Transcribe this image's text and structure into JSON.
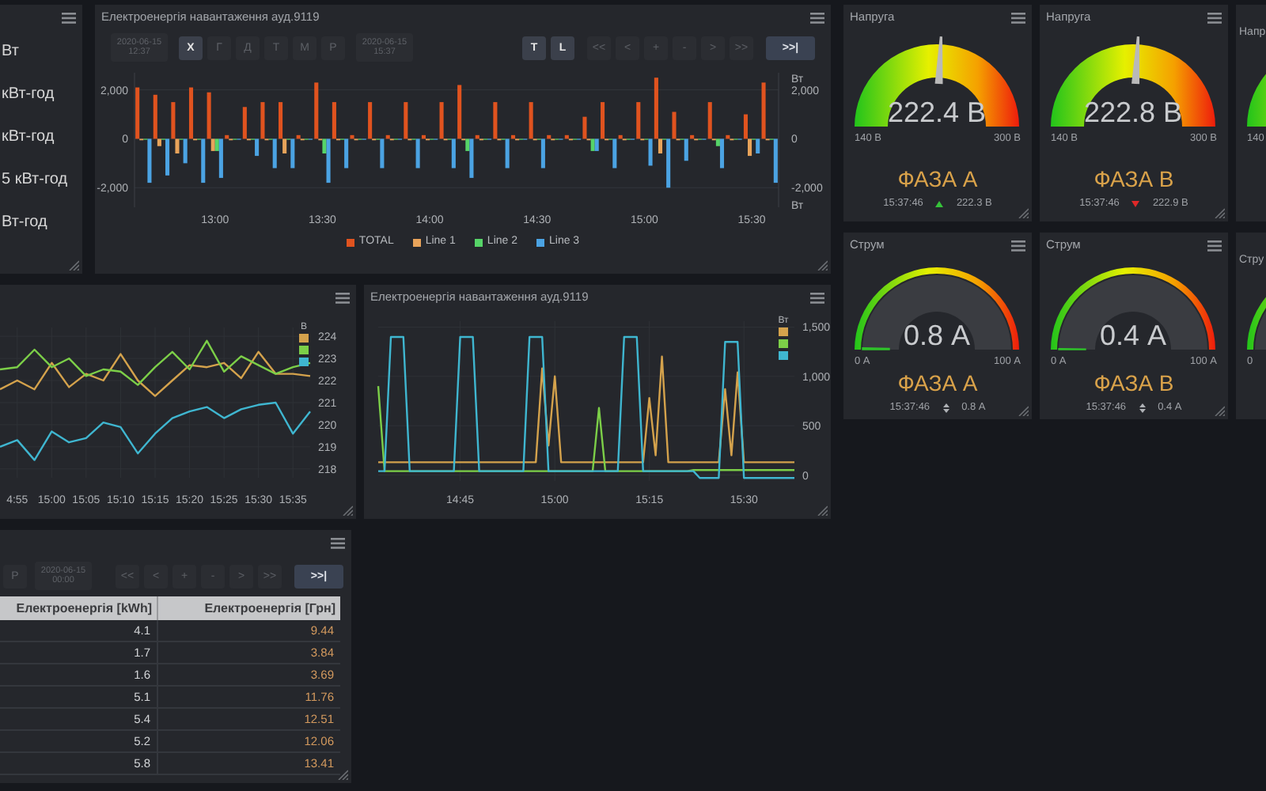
{
  "readings_panel": {
    "readings": [
      "Вт",
      "кВт-год",
      "кВт-год",
      "5 кВт-год",
      "Вт-год"
    ]
  },
  "energy_chart": {
    "title": "Електроенергія навантаження ауд.9119",
    "toolbar": {
      "start": "2020-06-15 12:37",
      "periods": [
        {
          "label": "Х",
          "selected": true
        },
        {
          "label": "Г",
          "selected": false
        },
        {
          "label": "Д",
          "selected": false
        },
        {
          "label": "Т",
          "selected": false
        },
        {
          "label": "М",
          "selected": false
        },
        {
          "label": "Р",
          "selected": false
        }
      ],
      "end": "2020-06-15 15:37",
      "modes": [
        {
          "label": "T",
          "selected": true
        },
        {
          "label": "L",
          "selected": true
        }
      ],
      "nav": [
        "<<",
        "<",
        "+",
        "-",
        ">",
        ">>"
      ],
      "live": ">>|"
    },
    "chart_data": {
      "type": "bar",
      "grid": true,
      "legend": "bottom",
      "y2label": "Вт",
      "annotations": [
        {
          "text": "Вт"
        }
      ],
      "ylim": [
        -2800,
        2700
      ],
      "y2lim": [
        -2800,
        2700
      ],
      "categories": [
        null,
        null,
        null,
        null,
        "13:00",
        null,
        null,
        null,
        null,
        null,
        "13:30",
        null,
        null,
        null,
        null,
        null,
        "14:00",
        null,
        null,
        null,
        null,
        null,
        "14:30",
        null,
        null,
        null,
        null,
        null,
        "15:00",
        null,
        null,
        null,
        null,
        null,
        "15:30",
        null
      ],
      "yticks": [
        {
          "value": 2000,
          "label": "2,000"
        },
        {
          "value": 0,
          "label": "0"
        },
        {
          "value": -2000,
          "label": "-2,000"
        }
      ],
      "y2ticks": [
        {
          "value": 2000,
          "label": "2,000"
        },
        {
          "value": 0,
          "label": "0"
        },
        {
          "value": -2000,
          "label": "-2,000"
        }
      ],
      "series": [
        {
          "name": "TOTAL",
          "color": "#e0531f",
          "values": [
            2100,
            1800,
            1500,
            2100,
            1900,
            150,
            1300,
            1500,
            1500,
            150,
            2300,
            1500,
            150,
            1500,
            150,
            1500,
            150,
            1500,
            2200,
            150,
            1500,
            150,
            1500,
            150,
            150,
            900,
            1500,
            150,
            1500,
            2500,
            1100,
            150,
            1500,
            150,
            1000,
            2300
          ]
        },
        {
          "name": "Line 1",
          "color": "#e8a35a",
          "values": [
            -60,
            -300,
            -600,
            -60,
            -500,
            -60,
            -60,
            -60,
            -600,
            -60,
            -60,
            -60,
            -60,
            -60,
            -60,
            -60,
            -60,
            -60,
            -60,
            -60,
            -60,
            -60,
            -60,
            -60,
            -60,
            -60,
            -60,
            -60,
            -60,
            -600,
            -60,
            -60,
            -60,
            -60,
            -700,
            -60
          ]
        },
        {
          "name": "Line 2",
          "color": "#56d468",
          "values": [
            -40,
            -40,
            -40,
            -40,
            -500,
            -40,
            -40,
            -40,
            -40,
            -40,
            -600,
            -40,
            -40,
            -40,
            -40,
            -40,
            -40,
            -40,
            -500,
            -40,
            -40,
            -40,
            -40,
            -40,
            -40,
            -500,
            -40,
            -40,
            -40,
            -40,
            -40,
            -40,
            -300,
            -40,
            -40,
            -40
          ]
        },
        {
          "name": "Line 3",
          "color": "#4ba3e3",
          "values": [
            -1800,
            -1500,
            -1000,
            -1800,
            -1600,
            -40,
            -700,
            -1200,
            -1200,
            -40,
            -1800,
            -1200,
            -40,
            -1200,
            -40,
            -1200,
            -40,
            -1200,
            -1600,
            -40,
            -1200,
            -40,
            -1200,
            -40,
            -40,
            -500,
            -1200,
            -40,
            -1100,
            -2000,
            -900,
            -40,
            -1200,
            -40,
            -600,
            -1800
          ]
        }
      ]
    }
  },
  "voltage_chart": {
    "chart_data": {
      "type": "line",
      "grid": true,
      "ylabel": "В",
      "ylim": [
        217.6,
        224.4
      ],
      "categories": [
        null,
        "4:55",
        null,
        "15:00",
        null,
        "15:05",
        null,
        "15:10",
        null,
        "15:15",
        null,
        "15:20",
        null,
        "15:25",
        null,
        "15:30",
        null,
        "15:35",
        null
      ],
      "yticks": [
        218,
        219,
        220,
        221,
        222,
        223,
        224
      ],
      "series": [
        {
          "color": "#d4a24c",
          "values": [
            221.6,
            222,
            221.6,
            222.8,
            221.7,
            222.3,
            222,
            223.2,
            222,
            221.3,
            222,
            222.7,
            222.6,
            222.8,
            222.1,
            223.3,
            222.3,
            222.3,
            222.2
          ]
        },
        {
          "color": "#7ccf48",
          "values": [
            222.5,
            222.6,
            223.4,
            222.6,
            223,
            222.2,
            222.5,
            222.4,
            221.8,
            222.6,
            223.3,
            222.5,
            223.8,
            222.4,
            223.1,
            222.7,
            222.3,
            222.6,
            222.8
          ]
        },
        {
          "color": "#3fb6d0",
          "values": [
            219,
            219.3,
            218.4,
            219.7,
            219.2,
            219.4,
            220.1,
            219.9,
            218.7,
            219.6,
            220.3,
            220.6,
            220.8,
            220.3,
            220.7,
            220.9,
            221,
            219.6,
            220.6
          ]
        }
      ]
    }
  },
  "power_chart": {
    "title": "Електроенергія навантаження ауд.9119",
    "chart_data": {
      "type": "line",
      "grid": true,
      "ylabel": "Вт",
      "ylim": [
        -60,
        1560
      ],
      "categories": [
        null,
        null,
        null,
        null,
        null,
        null,
        null,
        null,
        null,
        null,
        null,
        null,
        null,
        "14:45",
        null,
        null,
        null,
        null,
        null,
        null,
        null,
        null,
        null,
        null,
        null,
        null,
        null,
        null,
        "15:00",
        null,
        null,
        null,
        null,
        null,
        null,
        null,
        null,
        null,
        null,
        null,
        null,
        null,
        null,
        "15:15",
        null,
        null,
        null,
        null,
        null,
        null,
        null,
        null,
        null,
        null,
        null,
        null,
        null,
        null,
        "15:30",
        null,
        null,
        null,
        null,
        null,
        null,
        null,
        null
      ],
      "yticks": [
        {
          "value": 1500,
          "label": "1,500"
        },
        {
          "value": 1000,
          "label": "1,000"
        },
        {
          "value": 500,
          "label": "500"
        },
        {
          "value": 0,
          "label": "0"
        }
      ],
      "series": [
        {
          "color": "#d4a24c",
          "values": [
            130,
            130,
            130,
            130,
            130,
            130,
            130,
            130,
            130,
            130,
            130,
            130,
            130,
            130,
            130,
            130,
            130,
            130,
            130,
            130,
            130,
            130,
            130,
            130,
            130,
            130,
            1080,
            300,
            1000,
            130,
            130,
            130,
            130,
            130,
            130,
            130,
            130,
            130,
            130,
            130,
            130,
            130,
            130,
            780,
            200,
            1200,
            130,
            130,
            130,
            130,
            130,
            130,
            130,
            130,
            130,
            870,
            200,
            1040,
            130,
            130,
            130,
            130,
            130,
            130,
            130,
            130,
            130
          ]
        },
        {
          "color": "#7ccf48",
          "values": [
            900,
            40,
            40,
            40,
            40,
            40,
            40,
            40,
            40,
            40,
            40,
            40,
            40,
            40,
            40,
            40,
            40,
            40,
            40,
            40,
            40,
            40,
            40,
            40,
            40,
            40,
            40,
            40,
            40,
            40,
            40,
            40,
            40,
            40,
            40,
            680,
            40,
            40,
            40,
            40,
            40,
            40,
            40,
            40,
            40,
            40,
            40,
            40,
            40,
            40,
            50,
            50,
            50,
            50,
            50,
            50,
            50,
            50,
            50,
            50,
            50,
            50,
            50,
            50,
            50,
            50,
            50
          ]
        },
        {
          "color": "#3fb6d0",
          "values": [
            40,
            40,
            1400,
            1400,
            1400,
            40,
            40,
            40,
            40,
            40,
            40,
            40,
            40,
            1400,
            1400,
            1400,
            40,
            40,
            40,
            40,
            40,
            40,
            40,
            40,
            1400,
            1400,
            1400,
            40,
            40,
            40,
            40,
            40,
            40,
            40,
            40,
            40,
            40,
            40,
            40,
            1400,
            1400,
            1400,
            40,
            40,
            40,
            40,
            40,
            40,
            40,
            40,
            40,
            -30,
            -30,
            -30,
            -30,
            1350,
            1350,
            1350,
            -30,
            -30,
            -30,
            -30,
            -30,
            -30,
            -30,
            -30,
            -30
          ]
        }
      ]
    }
  },
  "energy_table": {
    "toolbar": {
      "periods": [
        {
          "label": "Р",
          "selected": false
        }
      ],
      "start": "2020-06-15 00:00",
      "nav": [
        "<<",
        "<",
        "+",
        "-",
        ">",
        ">>"
      ],
      "live": ">>|"
    },
    "columns": [
      "Електроенергія [kWh]",
      "Електроенергія [Грн]"
    ],
    "rows": [
      [
        "4.1",
        "9.44"
      ],
      [
        "1.7",
        "3.84"
      ],
      [
        "1.6",
        "3.69"
      ],
      [
        "5.1",
        "11.76"
      ],
      [
        "5.4",
        "12.51"
      ],
      [
        "5.2",
        "12.06"
      ],
      [
        "5.8",
        "13.41"
      ]
    ]
  },
  "gauge_rows": [
    {
      "gauges": [
        {
          "kind": "voltage",
          "title": "Напруга",
          "value": "222.4 В",
          "min": "140 В",
          "max": "300 В",
          "phase": "ФАЗА А",
          "time": "15:37:46",
          "rising": true,
          "falling": false,
          "previous": "222.3 В",
          "level": 0.515
        },
        {
          "kind": "voltage",
          "title": "Напруга",
          "value": "222.8 В",
          "min": "140 В",
          "max": "300 В",
          "phase": "ФАЗА В",
          "time": "15:37:46",
          "rising": false,
          "falling": true,
          "previous": "222.9 В",
          "level": 0.518
        }
      ],
      "cut": {
        "kind": "voltage",
        "title": "Напр",
        "min": "140"
      }
    },
    {
      "gauges": [
        {
          "kind": "current",
          "title": "Струм",
          "value": "0.8 А",
          "min": "0 А",
          "max": "100 А",
          "phase": "ФАЗА А",
          "time": "15:37:46",
          "rising": false,
          "falling": false,
          "previous": "0.8 А",
          "level": 0.008
        },
        {
          "kind": "current",
          "title": "Струм",
          "value": "0.4 А",
          "min": "0 А",
          "max": "100 А",
          "phase": "ФАЗА В",
          "time": "15:37:46",
          "rising": false,
          "falling": false,
          "previous": "0.4 А",
          "level": 0.004
        }
      ],
      "cut": {
        "kind": "current",
        "title": "Стру",
        "min": "0"
      }
    }
  ]
}
